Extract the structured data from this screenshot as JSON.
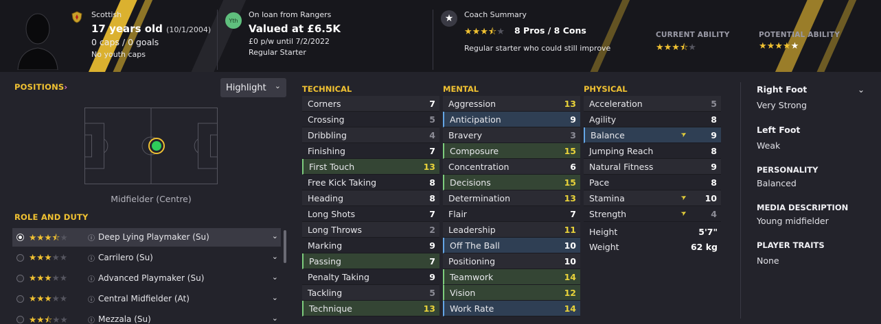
{
  "header": {
    "nationality": "Scottish",
    "age": "17 years old",
    "dob": "(10/1/2004)",
    "caps_goals": "0 caps / 0 goals",
    "youth_caps": "No youth caps",
    "club_badge": "Yth",
    "loan_status": "On loan from Rangers",
    "value": "Valued at £6.5K",
    "wage": "£0 p/w until 7/2/2022",
    "squad_status": "Regular Starter",
    "coach_summary_title": "Coach Summary",
    "pros_cons": "8 Pros / 8 Cons",
    "coach_summary_text": "Regular starter who could still improve",
    "coach_stars": 3.5,
    "current_ability_label": "CURRENT ABILITY",
    "current_ability_stars": 3.5,
    "potential_ability_label": "POTENTIAL ABILITY",
    "potential_ability_stars": 5
  },
  "positions": {
    "title": "POSITIONS",
    "highlight_label": "Highlight",
    "position_name": "Midfielder (Centre)"
  },
  "roles": {
    "title": "ROLE AND DUTY",
    "items": [
      {
        "name": "Deep Lying Playmaker (Su)",
        "stars": 3.5,
        "selected": true
      },
      {
        "name": "Carrilero (Su)",
        "stars": 3,
        "selected": false
      },
      {
        "name": "Advanced Playmaker (Su)",
        "stars": 3,
        "selected": false
      },
      {
        "name": "Central Midfielder (At)",
        "stars": 3,
        "selected": false
      },
      {
        "name": "Mezzala (Su)",
        "stars": 2.5,
        "selected": false
      }
    ]
  },
  "technical": {
    "title": "TECHNICAL",
    "rows": [
      {
        "name": "Corners",
        "value": "7"
      },
      {
        "name": "Crossing",
        "value": "5"
      },
      {
        "name": "Dribbling",
        "value": "4"
      },
      {
        "name": "Finishing",
        "value": "7"
      },
      {
        "name": "First Touch",
        "value": "13"
      },
      {
        "name": "Free Kick Taking",
        "value": "8"
      },
      {
        "name": "Heading",
        "value": "8"
      },
      {
        "name": "Long Shots",
        "value": "7"
      },
      {
        "name": "Long Throws",
        "value": "2"
      },
      {
        "name": "Marking",
        "value": "9"
      },
      {
        "name": "Passing",
        "value": "7"
      },
      {
        "name": "Penalty Taking",
        "value": "9"
      },
      {
        "name": "Tackling",
        "value": "5"
      },
      {
        "name": "Technique",
        "value": "13"
      }
    ]
  },
  "mental": {
    "title": "MENTAL",
    "rows": [
      {
        "name": "Aggression",
        "value": "13"
      },
      {
        "name": "Anticipation",
        "value": "9"
      },
      {
        "name": "Bravery",
        "value": "3"
      },
      {
        "name": "Composure",
        "value": "15"
      },
      {
        "name": "Concentration",
        "value": "6"
      },
      {
        "name": "Decisions",
        "value": "15"
      },
      {
        "name": "Determination",
        "value": "13"
      },
      {
        "name": "Flair",
        "value": "7"
      },
      {
        "name": "Leadership",
        "value": "11"
      },
      {
        "name": "Off The Ball",
        "value": "10"
      },
      {
        "name": "Positioning",
        "value": "10"
      },
      {
        "name": "Teamwork",
        "value": "14"
      },
      {
        "name": "Vision",
        "value": "12"
      },
      {
        "name": "Work Rate",
        "value": "14"
      }
    ]
  },
  "physical": {
    "title": "PHYSICAL",
    "rows": [
      {
        "name": "Acceleration",
        "value": "5"
      },
      {
        "name": "Agility",
        "value": "8"
      },
      {
        "name": "Balance",
        "value": "9"
      },
      {
        "name": "Jumping Reach",
        "value": "8"
      },
      {
        "name": "Natural Fitness",
        "value": "9"
      },
      {
        "name": "Pace",
        "value": "8"
      },
      {
        "name": "Stamina",
        "value": "10"
      },
      {
        "name": "Strength",
        "value": "4"
      }
    ],
    "height_label": "Height",
    "height_value": "5'7\"",
    "weight_label": "Weight",
    "weight_value": "62 kg"
  },
  "profile": {
    "foot_heading": "Right Foot",
    "foot_value": "Very Strong",
    "left_foot_heading": "Left Foot",
    "left_foot_value": "Weak",
    "personality_label": "PERSONALITY",
    "personality_value": "Balanced",
    "media_label": "MEDIA DESCRIPTION",
    "media_value": "Young midfielder",
    "traits_label": "PLAYER TRAITS",
    "traits_value": "None"
  },
  "colors": {
    "accent": "#f1c232",
    "bg": "#23232b",
    "header_bg": "#17171c",
    "positive": "#7dcd7d",
    "key_attribute": "#64a6e6"
  }
}
